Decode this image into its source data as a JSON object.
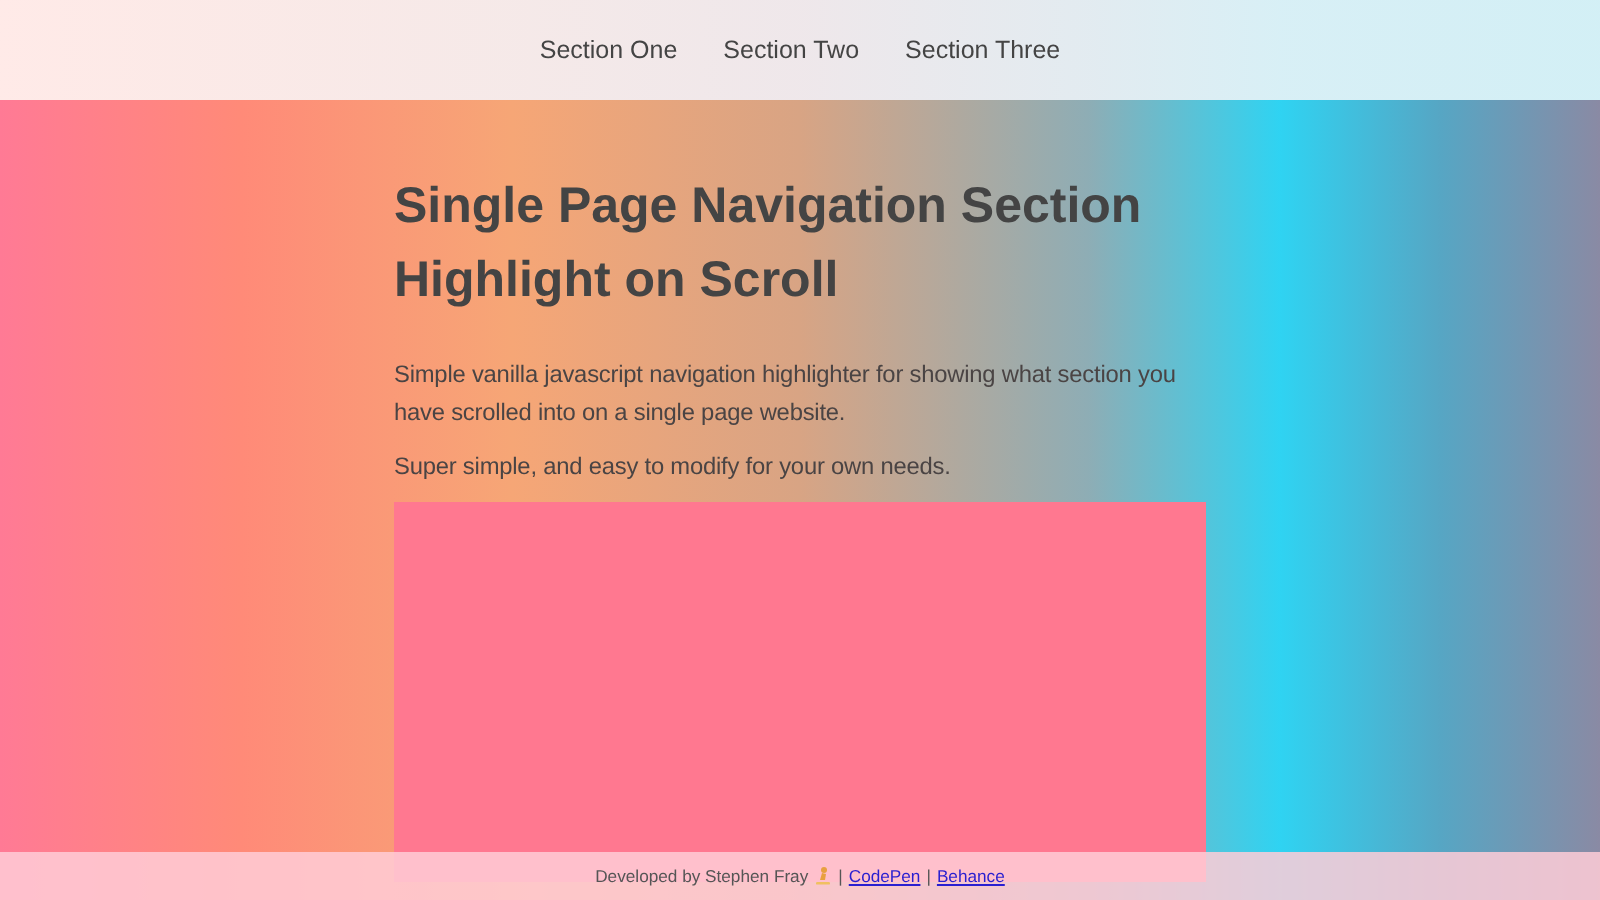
{
  "nav": {
    "items": [
      "Section One",
      "Section Two",
      "Section Three"
    ]
  },
  "hero": {
    "title": "Single Page Navigation Section Highlight on Scroll",
    "paragraphs": [
      "Simple vanilla javascript navigation highlighter for showing what section you have scrolled into on a single page website.",
      "Super simple, and easy to modify for your own needs."
    ]
  },
  "footer": {
    "credit": "Developed by Stephen Fray",
    "separators": [
      "|",
      "|"
    ],
    "links": [
      "CodePen",
      "Behance"
    ]
  }
}
